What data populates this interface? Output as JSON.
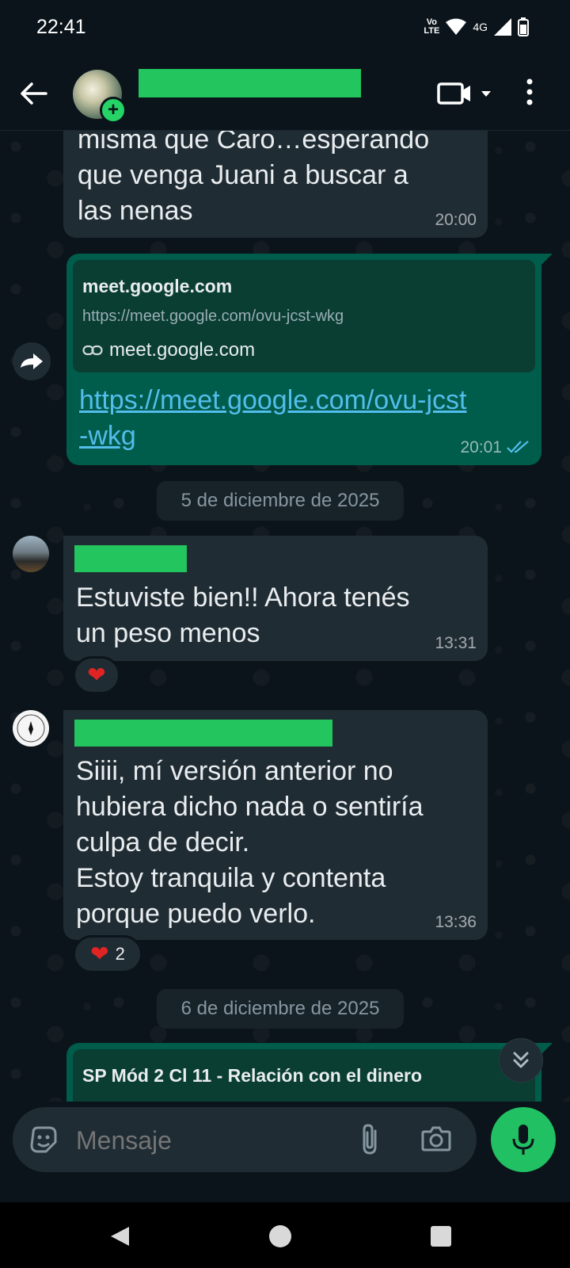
{
  "status_bar": {
    "time": "22:41",
    "volte": "Vo\nLTE",
    "network": "4G"
  },
  "header": {
    "contact_name": ""
  },
  "messages": {
    "m1": {
      "lines": [
        "misma que Caro…esperando",
        "que venga Juani a buscar a",
        "las nenas"
      ],
      "time": "20:00"
    },
    "m2": {
      "preview_title": "meet.google.com",
      "preview_url": "https://meet.google.com/ovu-jcst-wkg",
      "preview_domain": "meet.google.com",
      "link_lines": [
        "https://meet.google.com/ovu-jcst",
        "-wkg"
      ],
      "time": "20:01"
    },
    "date1": "5 de diciembre de 2025",
    "m3": {
      "lines": [
        "Estuviste bien!! Ahora tenés",
        "un peso menos"
      ],
      "time": "13:31",
      "reaction_count": ""
    },
    "m4": {
      "lines": [
        "Siiii, mí versión anterior no",
        "hubiera dicho nada o sentiría",
        "culpa de decir.",
        "Estoy tranquila y contenta",
        "porque puedo verlo."
      ],
      "time": "13:36",
      "reaction_count": "2"
    },
    "date2": "6 de diciembre de 2025",
    "m5": {
      "title": "SP Mód 2 Cl 11 - Relación con el dinero"
    }
  },
  "composer": {
    "placeholder": "Mensaje"
  },
  "colors": {
    "accent": "#21c063",
    "outgoing": "#005c4b",
    "incoming": "#202c33",
    "link": "#53bdeb",
    "read_tick": "#53bdeb"
  }
}
